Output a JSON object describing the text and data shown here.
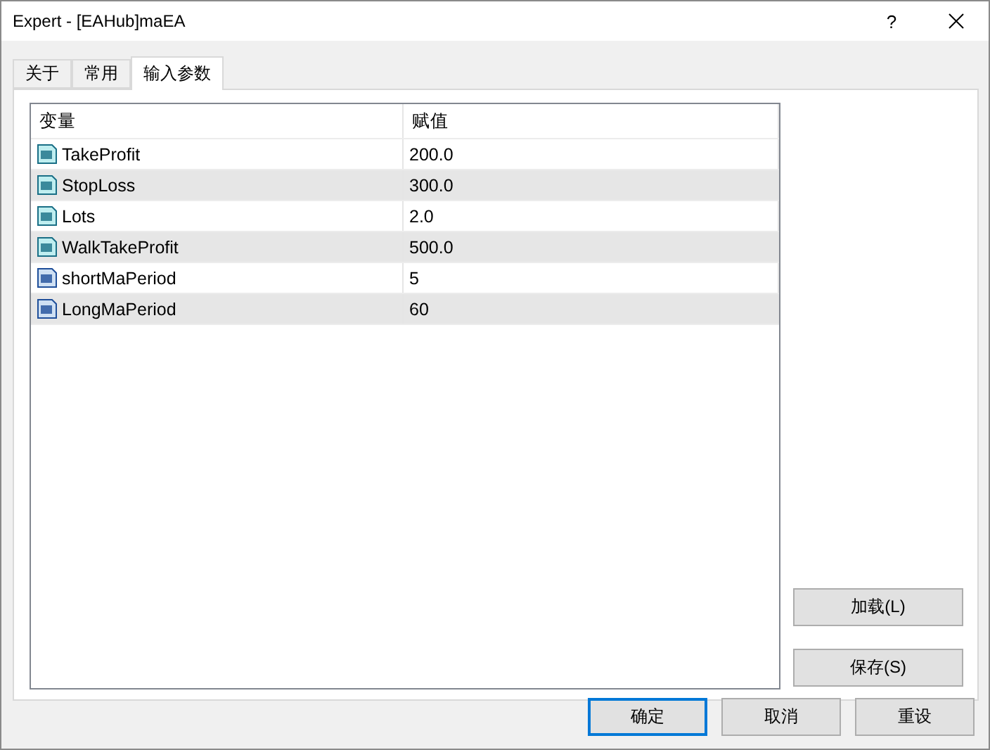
{
  "window": {
    "title": "Expert - [EAHub]maEA",
    "help_button": "?"
  },
  "tabs": [
    {
      "label": "关于",
      "selected": false
    },
    {
      "label": "常用",
      "selected": false
    },
    {
      "label": "输入参数",
      "selected": true
    }
  ],
  "table": {
    "columns": [
      "变量",
      "赋值"
    ],
    "rows": [
      {
        "kind": "double",
        "name": "TakeProfit",
        "value": "200.0"
      },
      {
        "kind": "double",
        "name": "StopLoss",
        "value": "300.0"
      },
      {
        "kind": "double",
        "name": "Lots",
        "value": "2.0"
      },
      {
        "kind": "double",
        "name": "WalkTakeProfit",
        "value": "500.0"
      },
      {
        "kind": "integer",
        "name": "shortMaPeriod",
        "value": "5"
      },
      {
        "kind": "integer",
        "name": "LongMaPeriod",
        "value": "60"
      }
    ]
  },
  "side_buttons": [
    "加载(L)",
    "保存(S)"
  ],
  "buttons": [
    {
      "label": "确定",
      "default": true
    },
    {
      "label": "取消",
      "default": false
    },
    {
      "label": "重设",
      "default": false
    }
  ]
}
